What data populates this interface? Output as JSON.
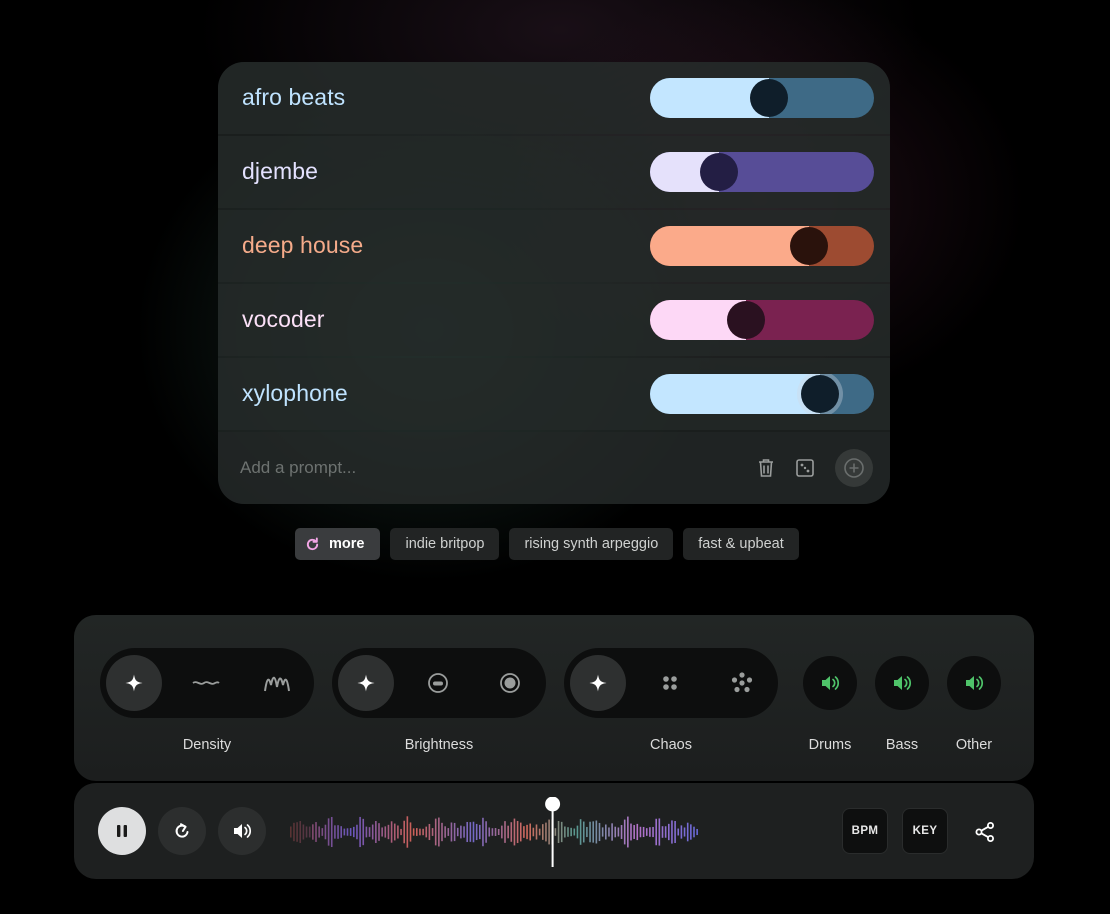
{
  "prompts": [
    {
      "label": "afro beats",
      "weight": 0.53,
      "text_color": "#bfe3ff",
      "track_left": "#c3e6ff",
      "track_right": "#3e6a86",
      "knob": "#0f1e2a",
      "active": false
    },
    {
      "label": "djembe",
      "weight": 0.31,
      "text_color": "#e4e2ff",
      "track_left": "#e5e1fb",
      "track_right": "#574d97",
      "knob": "#231e44",
      "active": false
    },
    {
      "label": "deep house",
      "weight": 0.71,
      "text_color": "#f5ab8a",
      "track_left": "#fbaa8a",
      "track_right": "#9d4b31",
      "knob": "#2a120c",
      "active": false
    },
    {
      "label": "vocoder",
      "weight": 0.43,
      "text_color": "#fbe0f7",
      "track_left": "#fdd8f6",
      "track_right": "#7a2250",
      "knob": "#2a1120",
      "active": false
    },
    {
      "label": "xylophone",
      "weight": 0.76,
      "text_color": "#bfe3ff",
      "track_left": "#c3e6ff",
      "track_right": "#3e6a86",
      "knob": "#0f1e2a",
      "active": true
    }
  ],
  "add_prompt": {
    "placeholder": "Add a prompt..."
  },
  "suggestions": {
    "more_label": "more",
    "chips": [
      "indie britpop",
      "rising synth arpeggio",
      "fast & upbeat"
    ]
  },
  "controls": {
    "groups": [
      {
        "label": "Density",
        "selected": 0,
        "icons": [
          "sparkle-icon",
          "wave-flat-icon",
          "wave-busy-icon"
        ]
      },
      {
        "label": "Brightness",
        "selected": 0,
        "icons": [
          "sparkle-icon",
          "circle-dim-icon",
          "circle-bright-icon"
        ]
      },
      {
        "label": "Chaos",
        "selected": 0,
        "icons": [
          "sparkle-icon",
          "dots-grid-icon",
          "dots-scatter-icon"
        ]
      }
    ],
    "stems": [
      {
        "label": "Drums",
        "icon": "speaker-icon"
      },
      {
        "label": "Bass",
        "icon": "speaker-icon"
      },
      {
        "label": "Other",
        "icon": "speaker-icon"
      }
    ],
    "accent_green": "#4fc46a"
  },
  "transport": {
    "bpm_label": "BPM",
    "key_label": "KEY",
    "playhead_fraction": 0.63,
    "state": "playing"
  }
}
